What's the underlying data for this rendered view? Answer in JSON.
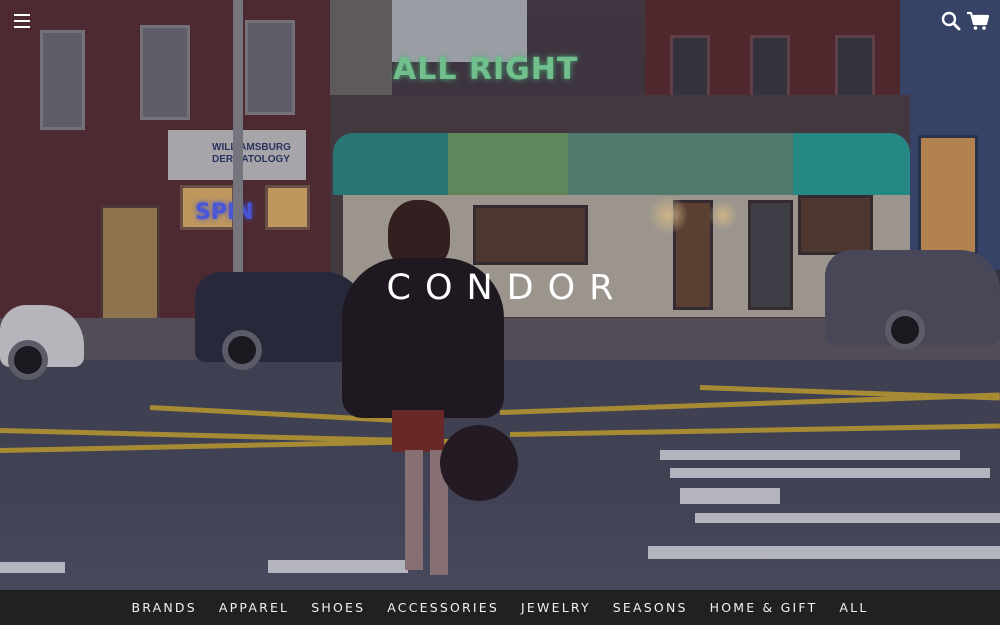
{
  "header": {
    "menu_icon": "hamburger-menu-icon",
    "search_icon": "search-icon",
    "cart_icon": "shopping-cart-icon"
  },
  "hero": {
    "logo": "CONDOR",
    "scene_signs": {
      "neon": "ALL RIGHT",
      "derm_line1": "WILLIAMSBURG",
      "derm_line2": "DERMATOLOGY",
      "side_sign": "SPIN"
    }
  },
  "nav": {
    "items": [
      {
        "label": "BRANDS"
      },
      {
        "label": "APPAREL"
      },
      {
        "label": "SHOES"
      },
      {
        "label": "ACCESSORIES"
      },
      {
        "label": "JEWELRY"
      },
      {
        "label": "SEASONS"
      },
      {
        "label": "HOME & GIFT"
      },
      {
        "label": "ALL"
      }
    ]
  },
  "colors": {
    "nav_background": "#212124",
    "text": "#ffffff",
    "neon": "#86e6a6"
  }
}
